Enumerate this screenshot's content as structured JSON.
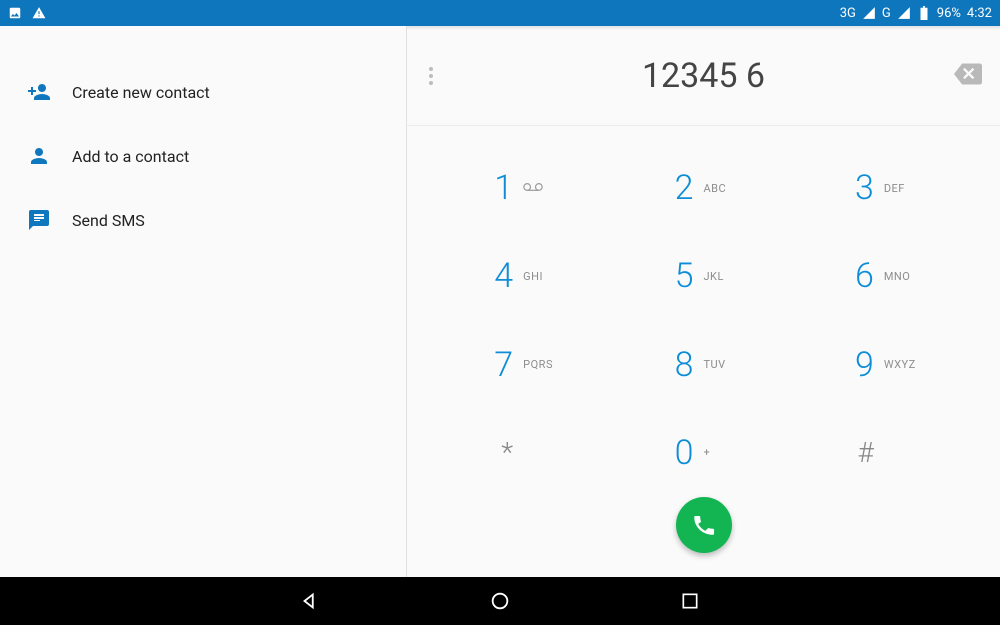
{
  "statusbar": {
    "signal1_label": "3G",
    "signal2_label": "G",
    "battery_pct": "96%",
    "clock": "4:32"
  },
  "actions": {
    "create_contact": "Create new contact",
    "add_contact": "Add to a contact",
    "send_sms": "Send SMS"
  },
  "dialer": {
    "number": "12345 6",
    "keys": {
      "k1": {
        "d": "1",
        "l": ""
      },
      "k2": {
        "d": "2",
        "l": "ABC"
      },
      "k3": {
        "d": "3",
        "l": "DEF"
      },
      "k4": {
        "d": "4",
        "l": "GHI"
      },
      "k5": {
        "d": "5",
        "l": "JKL"
      },
      "k6": {
        "d": "6",
        "l": "MNO"
      },
      "k7": {
        "d": "7",
        "l": "PQRS"
      },
      "k8": {
        "d": "8",
        "l": "TUV"
      },
      "k9": {
        "d": "9",
        "l": "WXYZ"
      },
      "kstar": {
        "d": "*",
        "l": ""
      },
      "k0": {
        "d": "0",
        "l": "+"
      },
      "khash": {
        "d": "#",
        "l": ""
      }
    }
  }
}
